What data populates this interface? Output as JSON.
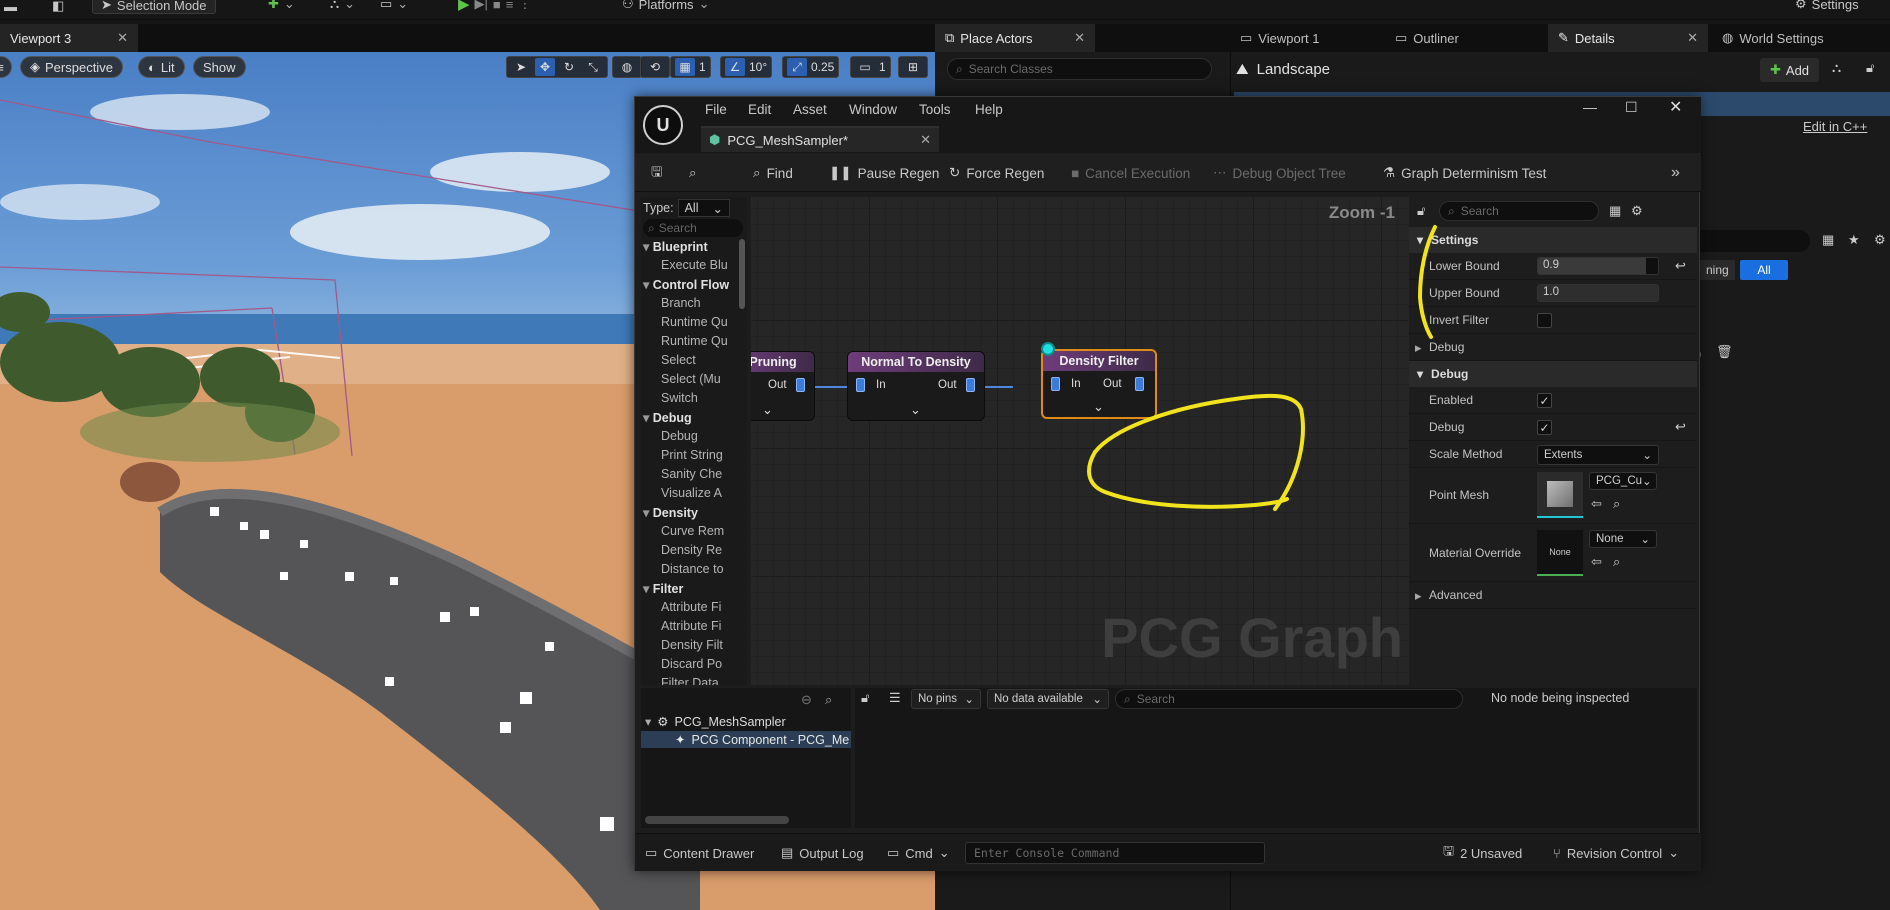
{
  "topbar": {
    "selection_mode": "Selection Mode",
    "platforms": "Platforms",
    "settings": "Settings"
  },
  "tabs": {
    "viewport3": "Viewport 3",
    "place_actors": "Place Actors",
    "viewport1": "Viewport 1",
    "outliner": "Outliner",
    "details": "Details",
    "world_settings": "World Settings"
  },
  "viewport": {
    "perspective": "Perspective",
    "lit": "Lit",
    "show": "Show",
    "grid_value": "1",
    "angle_value": "10°",
    "scale_value": "0.25",
    "camera_speed": "1"
  },
  "place_actors": {
    "search_placeholder": "Search Classes"
  },
  "details_panel": {
    "title": "Landscape",
    "add_label": "Add",
    "edit_cpp": "Edit in C++",
    "filter_partial": "ning",
    "filter_all": "All"
  },
  "pcg_window": {
    "menu": [
      "File",
      "Edit",
      "Asset",
      "Window",
      "Tools",
      "Help"
    ],
    "asset_tab": "PCG_MeshSampler*",
    "toolbar": {
      "find": "Find",
      "pause_regen": "Pause Regen",
      "force_regen": "Force Regen",
      "cancel_execution": "Cancel Execution",
      "debug_object_tree": "Debug Object Tree",
      "graph_determinism_test": "Graph Determinism Test"
    },
    "palette": {
      "type_label": "Type:",
      "type_value": "All",
      "search_placeholder": "Search",
      "items": [
        {
          "label": "Blueprint",
          "cat": true
        },
        {
          "label": "Execute Blu",
          "cat": false
        },
        {
          "label": "Control Flow",
          "cat": true
        },
        {
          "label": "Branch",
          "cat": false
        },
        {
          "label": "Runtime Qu",
          "cat": false
        },
        {
          "label": "Runtime Qu",
          "cat": false
        },
        {
          "label": "Select",
          "cat": false
        },
        {
          "label": "Select (Mu",
          "cat": false
        },
        {
          "label": "Switch",
          "cat": false
        },
        {
          "label": "Debug",
          "cat": true
        },
        {
          "label": "Debug",
          "cat": false
        },
        {
          "label": "Print String",
          "cat": false
        },
        {
          "label": "Sanity Che",
          "cat": false
        },
        {
          "label": "Visualize A",
          "cat": false
        },
        {
          "label": "Density",
          "cat": true
        },
        {
          "label": "Curve Rem",
          "cat": false
        },
        {
          "label": "Density Re",
          "cat": false
        },
        {
          "label": "Distance to",
          "cat": false
        },
        {
          "label": "Filter",
          "cat": true
        },
        {
          "label": "Attribute Fi",
          "cat": false
        },
        {
          "label": "Attribute Fi",
          "cat": false
        },
        {
          "label": "Density Filt",
          "cat": false
        },
        {
          "label": "Discard Po",
          "cat": false
        },
        {
          "label": "Filter Data",
          "cat": false
        }
      ]
    },
    "graph": {
      "zoom": "Zoom -1",
      "watermark": "PCG Graph",
      "nodes": {
        "pruning": {
          "title": "Pruning",
          "out": "Out"
        },
        "normal": {
          "title": "Normal To Density",
          "in": "In",
          "out": "Out"
        },
        "density": {
          "title": "Density Filter",
          "in": "In",
          "out": "Out"
        }
      }
    },
    "details": {
      "search_placeholder": "Search",
      "settings_section": "Settings",
      "lower_bound_label": "Lower Bound",
      "lower_bound_value": "0.9",
      "upper_bound_label": "Upper Bound",
      "upper_bound_value": "1.0",
      "invert_filter_label": "Invert Filter",
      "debug_sub_label": "Debug",
      "debug_section": "Debug",
      "enabled_label": "Enabled",
      "enabled": true,
      "debug_label": "Debug",
      "debug": true,
      "scale_method_label": "Scale Method",
      "scale_method_value": "Extents",
      "point_mesh_label": "Point Mesh",
      "point_mesh_value": "PCG_Cu",
      "material_override_label": "Material Override",
      "material_override_value": "None",
      "material_thumb": "None",
      "advanced_label": "Advanced"
    },
    "debug_tree": {
      "root": "PCG_MeshSampler",
      "child": "PCG Component - PCG_Me"
    },
    "inspector": {
      "pins": "No pins",
      "data": "No data available",
      "search_placeholder": "Search",
      "status": "No node being inspected"
    },
    "statusbar": {
      "content_drawer": "Content Drawer",
      "output_log": "Output Log",
      "cmd": "Cmd",
      "console_placeholder": "Enter Console Command",
      "unsaved": "2 Unsaved",
      "revision_control": "Revision Control"
    }
  },
  "colors": {
    "annotation": "#f2e41c",
    "accent": "#1a6fe0",
    "node_selected": "#e08a18"
  }
}
